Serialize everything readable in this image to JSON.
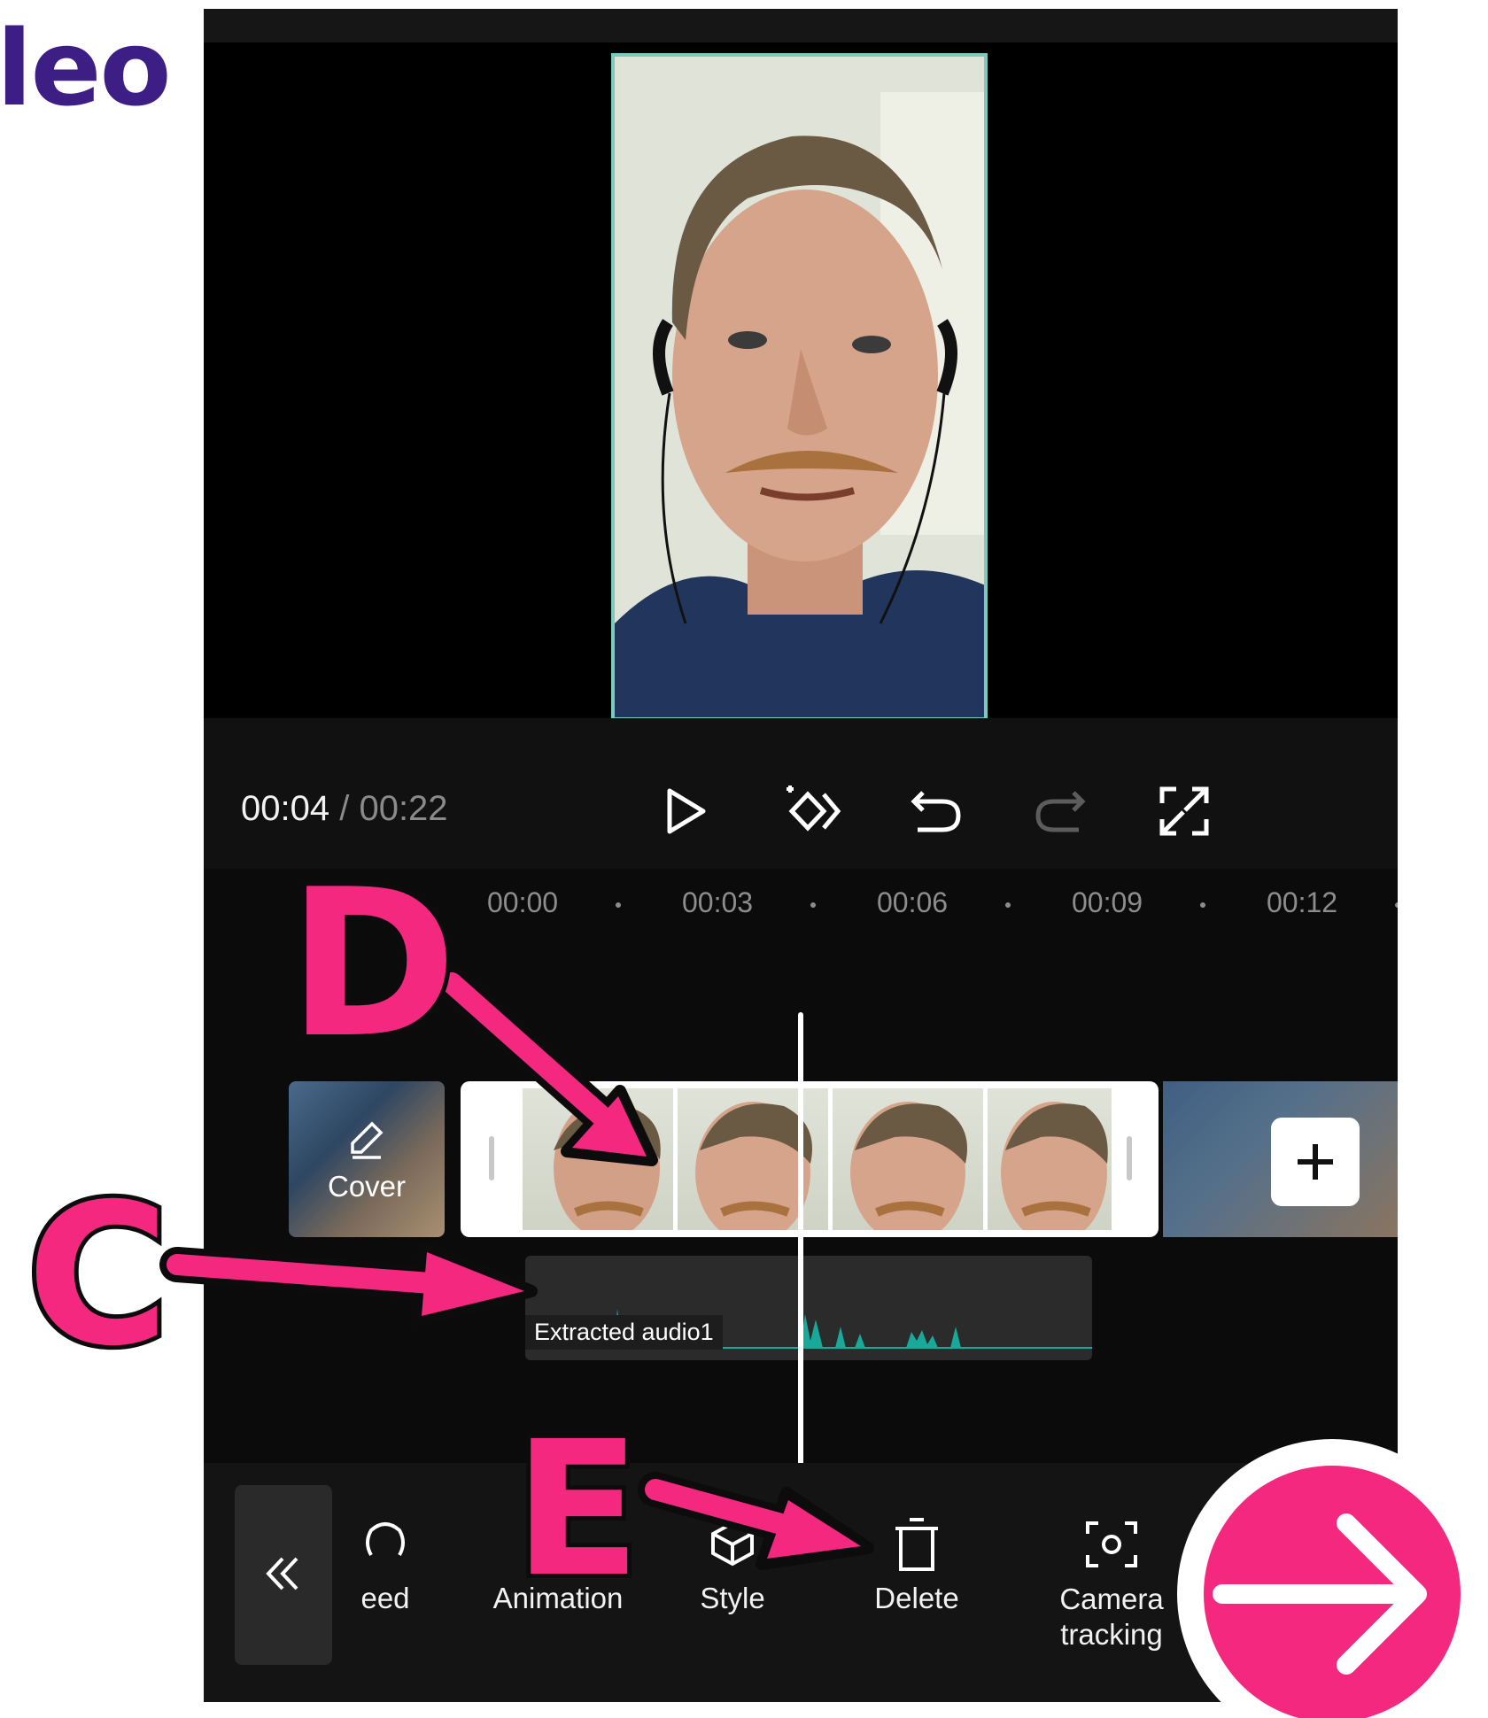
{
  "brand": {
    "text": "leo"
  },
  "player": {
    "current_time": "00:04",
    "separator": " / ",
    "total_time": "00:22"
  },
  "controls": {
    "icons": [
      "play-icon",
      "keyframe-icon",
      "undo-icon",
      "redo-icon",
      "fullscreen-icon"
    ]
  },
  "ruler": {
    "ticks": [
      "00:00",
      "00:03",
      "00:06",
      "00:09",
      "00:12"
    ]
  },
  "timeline": {
    "cover_label": "Cover",
    "audio_label": "Extracted audio1"
  },
  "toolbar": {
    "items": [
      {
        "label": "eed",
        "icon": "speed-icon"
      },
      {
        "label": "Animation",
        "icon": "animation-icon"
      },
      {
        "label": "Style",
        "icon": "style-icon"
      },
      {
        "label": "Delete",
        "icon": "trash-icon"
      },
      {
        "label": "Camera tracking",
        "icon": "camera-tracking-icon"
      }
    ]
  },
  "annotations": {
    "letter_c": "C",
    "letter_d": "D",
    "letter_e": "E"
  },
  "colors": {
    "accent_pink": "#f5287f",
    "brand_purple": "#3d1e85",
    "frame_teal": "#7ec9bd",
    "waveform": "#18a99a"
  }
}
